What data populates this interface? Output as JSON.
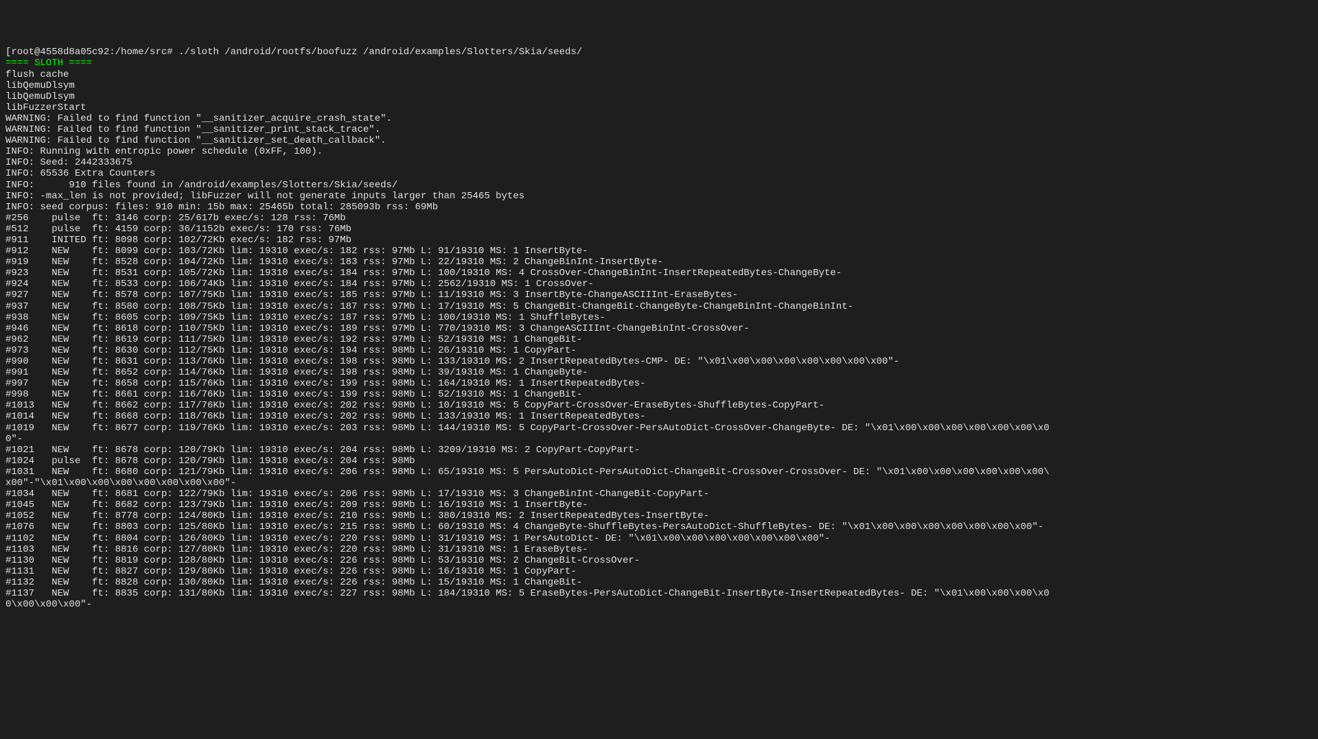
{
  "prompt": {
    "bracket_open": "[",
    "user_host": "root@4558d8a05c92",
    "separator": ":",
    "path": "/home/src",
    "hash": "#",
    "command": " ./sloth /android/rootfs/boofuzz /android/examples/Slotters/Skia/seeds/",
    "bracket_close": "]"
  },
  "banner": "==== SLOTH ====",
  "lines": [
    "flush cache",
    "libQemuDlsym",
    "libQemuDlsym",
    "libFuzzerStart",
    "WARNING: Failed to find function \"__sanitizer_acquire_crash_state\".",
    "WARNING: Failed to find function \"__sanitizer_print_stack_trace\".",
    "WARNING: Failed to find function \"__sanitizer_set_death_callback\".",
    "INFO: Running with entropic power schedule (0xFF, 100).",
    "INFO: Seed: 2442333675",
    "INFO: 65536 Extra Counters",
    "INFO:      910 files found in /android/examples/Slotters/Skia/seeds/",
    "INFO: -max_len is not provided; libFuzzer will not generate inputs larger than 25465 bytes",
    "INFO: seed corpus: files: 910 min: 15b max: 25465b total: 285093b rss: 69Mb",
    "#256    pulse  ft: 3146 corp: 25/617b exec/s: 128 rss: 76Mb",
    "#512    pulse  ft: 4159 corp: 36/1152b exec/s: 170 rss: 76Mb",
    "#911    INITED ft: 8098 corp: 102/72Kb exec/s: 182 rss: 97Mb",
    "#912    NEW    ft: 8099 corp: 103/72Kb lim: 19310 exec/s: 182 rss: 97Mb L: 91/19310 MS: 1 InsertByte-",
    "#919    NEW    ft: 8528 corp: 104/72Kb lim: 19310 exec/s: 183 rss: 97Mb L: 22/19310 MS: 2 ChangeBinInt-InsertByte-",
    "#923    NEW    ft: 8531 corp: 105/72Kb lim: 19310 exec/s: 184 rss: 97Mb L: 100/19310 MS: 4 CrossOver-ChangeBinInt-InsertRepeatedBytes-ChangeByte-",
    "#924    NEW    ft: 8533 corp: 106/74Kb lim: 19310 exec/s: 184 rss: 97Mb L: 2562/19310 MS: 1 CrossOver-",
    "#927    NEW    ft: 8578 corp: 107/75Kb lim: 19310 exec/s: 185 rss: 97Mb L: 11/19310 MS: 3 InsertByte-ChangeASCIIInt-EraseBytes-",
    "#937    NEW    ft: 8580 corp: 108/75Kb lim: 19310 exec/s: 187 rss: 97Mb L: 17/19310 MS: 5 ChangeBit-ChangeBit-ChangeByte-ChangeBinInt-ChangeBinInt-",
    "#938    NEW    ft: 8605 corp: 109/75Kb lim: 19310 exec/s: 187 rss: 97Mb L: 100/19310 MS: 1 ShuffleBytes-",
    "#946    NEW    ft: 8618 corp: 110/75Kb lim: 19310 exec/s: 189 rss: 97Mb L: 770/19310 MS: 3 ChangeASCIIInt-ChangeBinInt-CrossOver-",
    "#962    NEW    ft: 8619 corp: 111/75Kb lim: 19310 exec/s: 192 rss: 97Mb L: 52/19310 MS: 1 ChangeBit-",
    "#973    NEW    ft: 8630 corp: 112/75Kb lim: 19310 exec/s: 194 rss: 98Mb L: 26/19310 MS: 1 CopyPart-",
    "#990    NEW    ft: 8631 corp: 113/76Kb lim: 19310 exec/s: 198 rss: 98Mb L: 133/19310 MS: 2 InsertRepeatedBytes-CMP- DE: \"\\x01\\x00\\x00\\x00\\x00\\x00\\x00\\x00\"-",
    "#991    NEW    ft: 8652 corp: 114/76Kb lim: 19310 exec/s: 198 rss: 98Mb L: 39/19310 MS: 1 ChangeByte-",
    "#997    NEW    ft: 8658 corp: 115/76Kb lim: 19310 exec/s: 199 rss: 98Mb L: 164/19310 MS: 1 InsertRepeatedBytes-",
    "#998    NEW    ft: 8661 corp: 116/76Kb lim: 19310 exec/s: 199 rss: 98Mb L: 52/19310 MS: 1 ChangeBit-",
    "#1013   NEW    ft: 8662 corp: 117/76Kb lim: 19310 exec/s: 202 rss: 98Mb L: 10/19310 MS: 5 CopyPart-CrossOver-EraseBytes-ShuffleBytes-CopyPart-",
    "#1014   NEW    ft: 8668 corp: 118/76Kb lim: 19310 exec/s: 202 rss: 98Mb L: 133/19310 MS: 1 InsertRepeatedBytes-",
    "#1019   NEW    ft: 8677 corp: 119/76Kb lim: 19310 exec/s: 203 rss: 98Mb L: 144/19310 MS: 5 CopyPart-CrossOver-PersAutoDict-CrossOver-ChangeByte- DE: \"\\x01\\x00\\x00\\x00\\x00\\x00\\x00\\x0",
    "0\"-",
    "#1021   NEW    ft: 8678 corp: 120/79Kb lim: 19310 exec/s: 204 rss: 98Mb L: 3209/19310 MS: 2 CopyPart-CopyPart-",
    "#1024   pulse  ft: 8678 corp: 120/79Kb lim: 19310 exec/s: 204 rss: 98Mb",
    "#1031   NEW    ft: 8680 corp: 121/79Kb lim: 19310 exec/s: 206 rss: 98Mb L: 65/19310 MS: 5 PersAutoDict-PersAutoDict-ChangeBit-CrossOver-CrossOver- DE: \"\\x01\\x00\\x00\\x00\\x00\\x00\\x00\\",
    "x00\"-\"\\x01\\x00\\x00\\x00\\x00\\x00\\x00\\x00\"-",
    "#1034   NEW    ft: 8681 corp: 122/79Kb lim: 19310 exec/s: 206 rss: 98Mb L: 17/19310 MS: 3 ChangeBinInt-ChangeBit-CopyPart-",
    "#1045   NEW    ft: 8682 corp: 123/79Kb lim: 19310 exec/s: 209 rss: 98Mb L: 16/19310 MS: 1 InsertByte-",
    "#1052   NEW    ft: 8778 corp: 124/80Kb lim: 19310 exec/s: 210 rss: 98Mb L: 380/19310 MS: 2 InsertRepeatedBytes-InsertByte-",
    "#1076   NEW    ft: 8803 corp: 125/80Kb lim: 19310 exec/s: 215 rss: 98Mb L: 60/19310 MS: 4 ChangeByte-ShuffleBytes-PersAutoDict-ShuffleBytes- DE: \"\\x01\\x00\\x00\\x00\\x00\\x00\\x00\\x00\"-",
    "#1102   NEW    ft: 8804 corp: 126/80Kb lim: 19310 exec/s: 220 rss: 98Mb L: 31/19310 MS: 1 PersAutoDict- DE: \"\\x01\\x00\\x00\\x00\\x00\\x00\\x00\\x00\"-",
    "#1103   NEW    ft: 8816 corp: 127/80Kb lim: 19310 exec/s: 220 rss: 98Mb L: 31/19310 MS: 1 EraseBytes-",
    "#1130   NEW    ft: 8819 corp: 128/80Kb lim: 19310 exec/s: 226 rss: 98Mb L: 53/19310 MS: 2 ChangeBit-CrossOver-",
    "#1131   NEW    ft: 8827 corp: 129/80Kb lim: 19310 exec/s: 226 rss: 98Mb L: 16/19310 MS: 1 CopyPart-",
    "#1132   NEW    ft: 8828 corp: 130/80Kb lim: 19310 exec/s: 226 rss: 98Mb L: 15/19310 MS: 1 ChangeBit-",
    "#1137   NEW    ft: 8835 corp: 131/80Kb lim: 19310 exec/s: 227 rss: 98Mb L: 184/19310 MS: 5 EraseBytes-PersAutoDict-ChangeBit-InsertByte-InsertRepeatedBytes- DE: \"\\x01\\x00\\x00\\x00\\x0",
    "0\\x00\\x00\\x00\"-"
  ]
}
